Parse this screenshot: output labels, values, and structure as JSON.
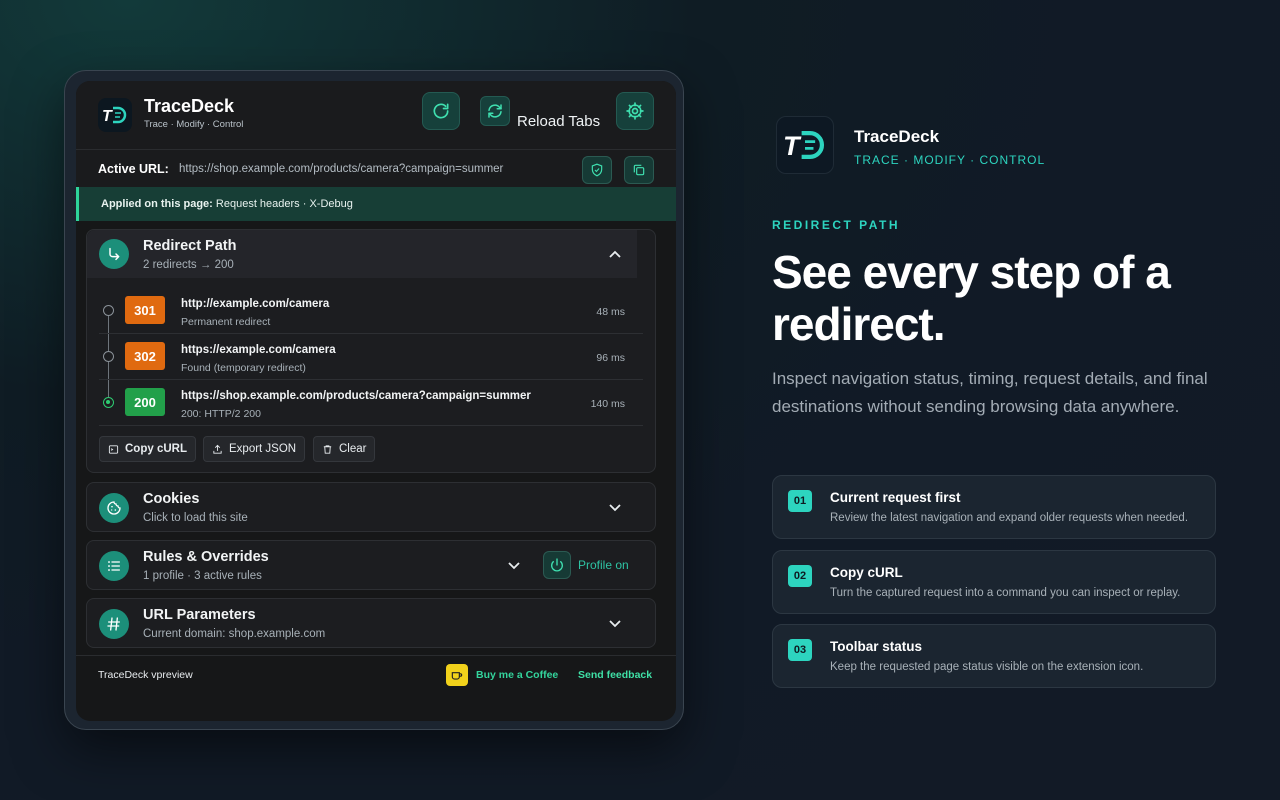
{
  "colors": {
    "accent": "#2dd4bf",
    "code_301": "#e06a10",
    "code_302": "#e06a10",
    "code_200": "#22a04a"
  },
  "popup": {
    "brand": {
      "name": "TraceDeck",
      "tagline": "Trace · Modify · Control",
      "logo_text": "TD"
    },
    "header": {
      "reload_tabs_label": "Reload Tabs",
      "icons": [
        "refresh-icon",
        "reload-tabs-icon",
        "settings-gear-icon"
      ]
    },
    "active_url": {
      "label": "Active URL:",
      "value": "https://shop.example.com/products/camera?campaign=summer"
    },
    "applied": {
      "label": "Applied on this page:",
      "value": "Request headers · X-Debug"
    },
    "redirect_path": {
      "title": "Redirect Path",
      "subtitle": "2 redirects → 200",
      "hops": [
        {
          "code": "301",
          "url": "http://example.com/camera",
          "desc": "Permanent redirect",
          "ms": "48 ms"
        },
        {
          "code": "302",
          "url": "https://example.com/camera",
          "desc": "Found (temporary redirect)",
          "ms": "96 ms"
        },
        {
          "code": "200",
          "url": "https://shop.example.com/products/camera?campaign=summer",
          "desc": "200: HTTP/2 200",
          "ms": "140 ms"
        }
      ],
      "actions": {
        "copy_curl": "Copy cURL",
        "export_json": "Export JSON",
        "clear": "Clear"
      }
    },
    "cookies": {
      "title": "Cookies",
      "subtitle": "Click to load this site"
    },
    "rules": {
      "title": "Rules & Overrides",
      "subtitle": "1 profile · 3 active rules",
      "profile_label": "Profile on"
    },
    "url_params": {
      "title": "URL Parameters",
      "subtitle": "Current domain: shop.example.com"
    },
    "footer": {
      "version": "TraceDeck vpreview",
      "coffee": "Buy me a Coffee",
      "feedback": "Send feedback"
    }
  },
  "marketing": {
    "brand": "TraceDeck",
    "tagline": "TRACE · MODIFY · CONTROL",
    "eyebrow": "REDIRECT PATH",
    "headline": "See every step of a redirect.",
    "body": "Inspect navigation status, timing, request details, and final destinations without sending browsing data anywhere.",
    "features": [
      {
        "num": "01",
        "title": "Current request first",
        "desc": "Review the latest navigation and expand older requests when needed."
      },
      {
        "num": "02",
        "title": "Copy cURL",
        "desc": "Turn the captured request into a command you can inspect or replay."
      },
      {
        "num": "03",
        "title": "Toolbar status",
        "desc": "Keep the requested page status visible on the extension icon."
      }
    ]
  }
}
